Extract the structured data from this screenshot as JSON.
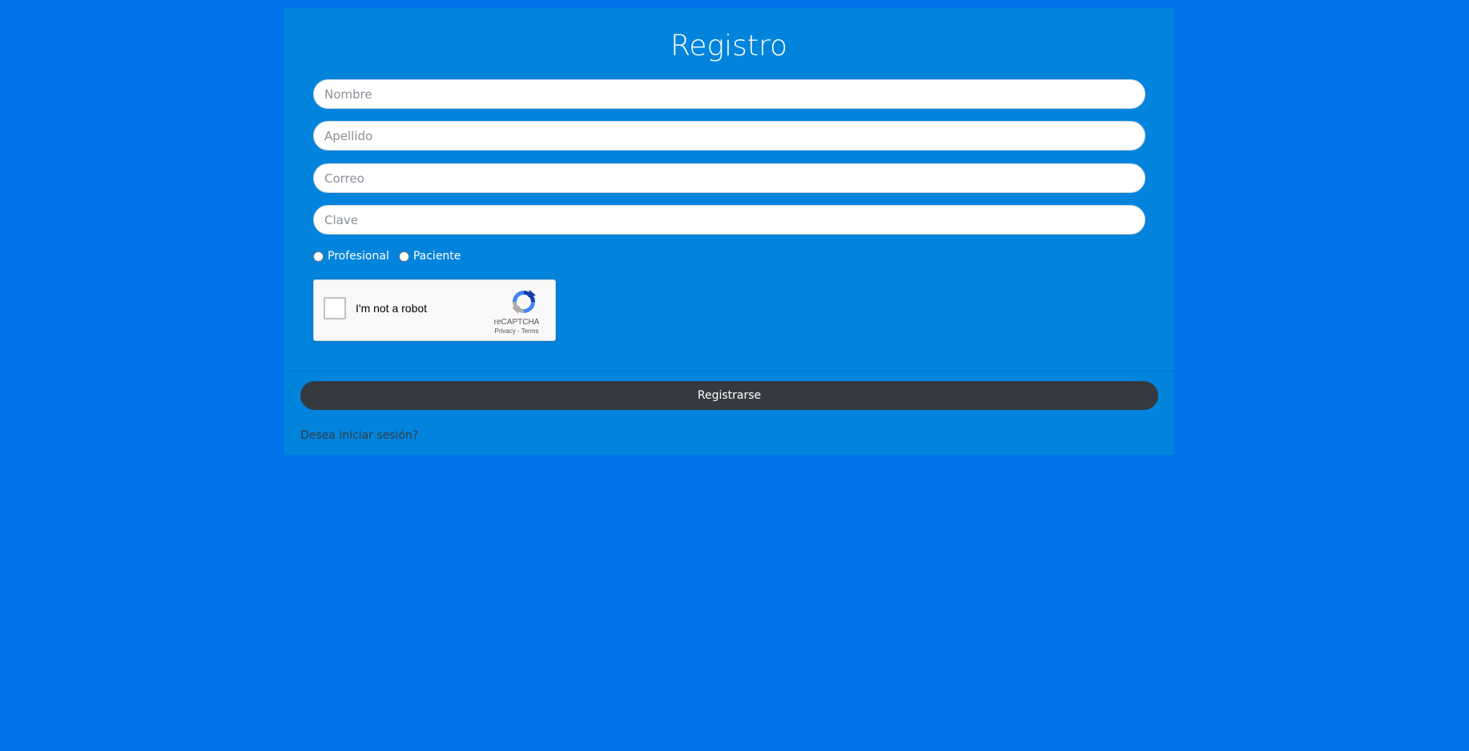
{
  "form": {
    "title": "Registro",
    "fields": {
      "nombre": {
        "placeholder": "Nombre",
        "value": ""
      },
      "apellido": {
        "placeholder": "Apellido",
        "value": ""
      },
      "correo": {
        "placeholder": "Correo",
        "value": ""
      },
      "clave": {
        "placeholder": "Clave",
        "value": ""
      }
    },
    "role_options": [
      {
        "label": "Profesional",
        "selected": false
      },
      {
        "label": "Paciente",
        "selected": false
      }
    ],
    "captcha": {
      "label": "I'm not a robot",
      "brand": "reCAPTCHA",
      "links": "Privacy - Terms",
      "icon": "recaptcha-logo-icon"
    },
    "submit_label": "Registrarse",
    "login_link": "Desea iniciar sesión?"
  },
  "colors": {
    "page_background": "#0073ea",
    "card_background": "#0284dd",
    "button_background": "#343a40",
    "text_light": "#ffffff"
  }
}
